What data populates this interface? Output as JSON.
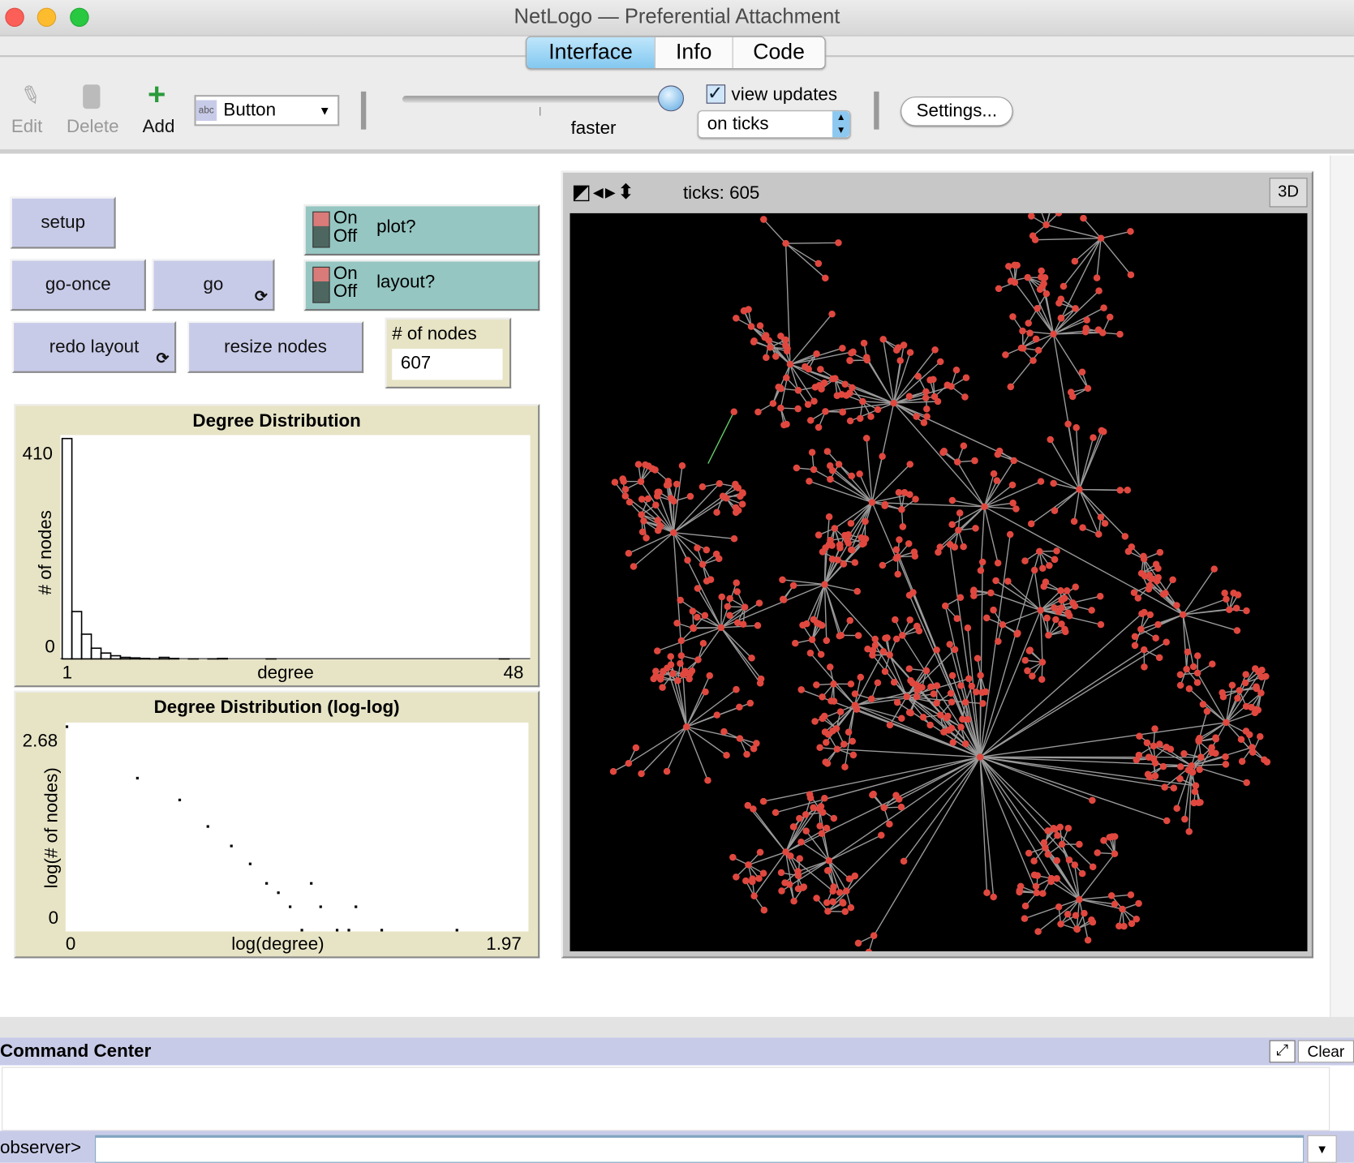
{
  "window": {
    "title": "NetLogo — Preferential Attachment"
  },
  "tabs": [
    {
      "label": "Interface",
      "selected": true
    },
    {
      "label": "Info"
    },
    {
      "label": "Code"
    }
  ],
  "toolbar": {
    "edit": "Edit",
    "delete": "Delete",
    "add": "Add",
    "widget_type": "Button",
    "speed_label": "faster",
    "view_updates_label": "view updates",
    "view_updates_checked": true,
    "update_mode": "on ticks",
    "settings": "Settings..."
  },
  "widgets": {
    "setup": "setup",
    "go_once": "go-once",
    "go": "go",
    "redo_layout": "redo layout",
    "resize_nodes": "resize nodes",
    "switch_on": "On",
    "switch_off": "Off",
    "plot_switch": "plot?",
    "layout_switch": "layout?",
    "monitor_label": "# of nodes",
    "monitor_value": "607"
  },
  "view": {
    "ticks_label": "ticks: 605",
    "three_d": "3D",
    "background": "#000000",
    "node_color": "#e0483f",
    "link_color": "#9a9a9a"
  },
  "command_center": {
    "title": "Command Center",
    "clear": "Clear",
    "prompt": "observer>",
    "input": ""
  },
  "chart_data": [
    {
      "type": "bar",
      "title": "Degree Distribution",
      "xlabel": "degree",
      "ylabel": "# of nodes",
      "xlim": [
        1,
        48
      ],
      "ylim": [
        0,
        410
      ],
      "x_tick_labels": [
        "1",
        "48"
      ],
      "y_tick_labels": [
        "0",
        "410"
      ],
      "x": [
        1,
        2,
        3,
        4,
        5,
        6,
        7,
        8,
        9,
        10,
        11,
        12,
        14,
        16,
        17,
        22,
        46
      ],
      "values": [
        410,
        89,
        47,
        21,
        12,
        7,
        4,
        3,
        2,
        1,
        4,
        2,
        1,
        1,
        2,
        1,
        1
      ]
    },
    {
      "type": "scatter",
      "title": "Degree Distribution (log-log)",
      "xlabel": "log(degree)",
      "ylabel": "log(# of nodes)",
      "xlim": [
        0,
        1.97
      ],
      "ylim": [
        0,
        2.68
      ],
      "x_tick_labels": [
        "0",
        "1.97"
      ],
      "y_tick_labels": [
        "0",
        "2.68"
      ],
      "x": [
        0,
        0.3,
        0.48,
        0.6,
        0.7,
        0.78,
        0.85,
        0.9,
        0.95,
        1.0,
        1.04,
        1.08,
        1.15,
        1.2,
        1.23,
        1.34,
        1.66
      ],
      "y": [
        2.61,
        1.95,
        1.67,
        1.33,
        1.08,
        0.85,
        0.6,
        0.48,
        0.3,
        0,
        0.6,
        0.3,
        0,
        0,
        0.3,
        0,
        0
      ]
    }
  ]
}
